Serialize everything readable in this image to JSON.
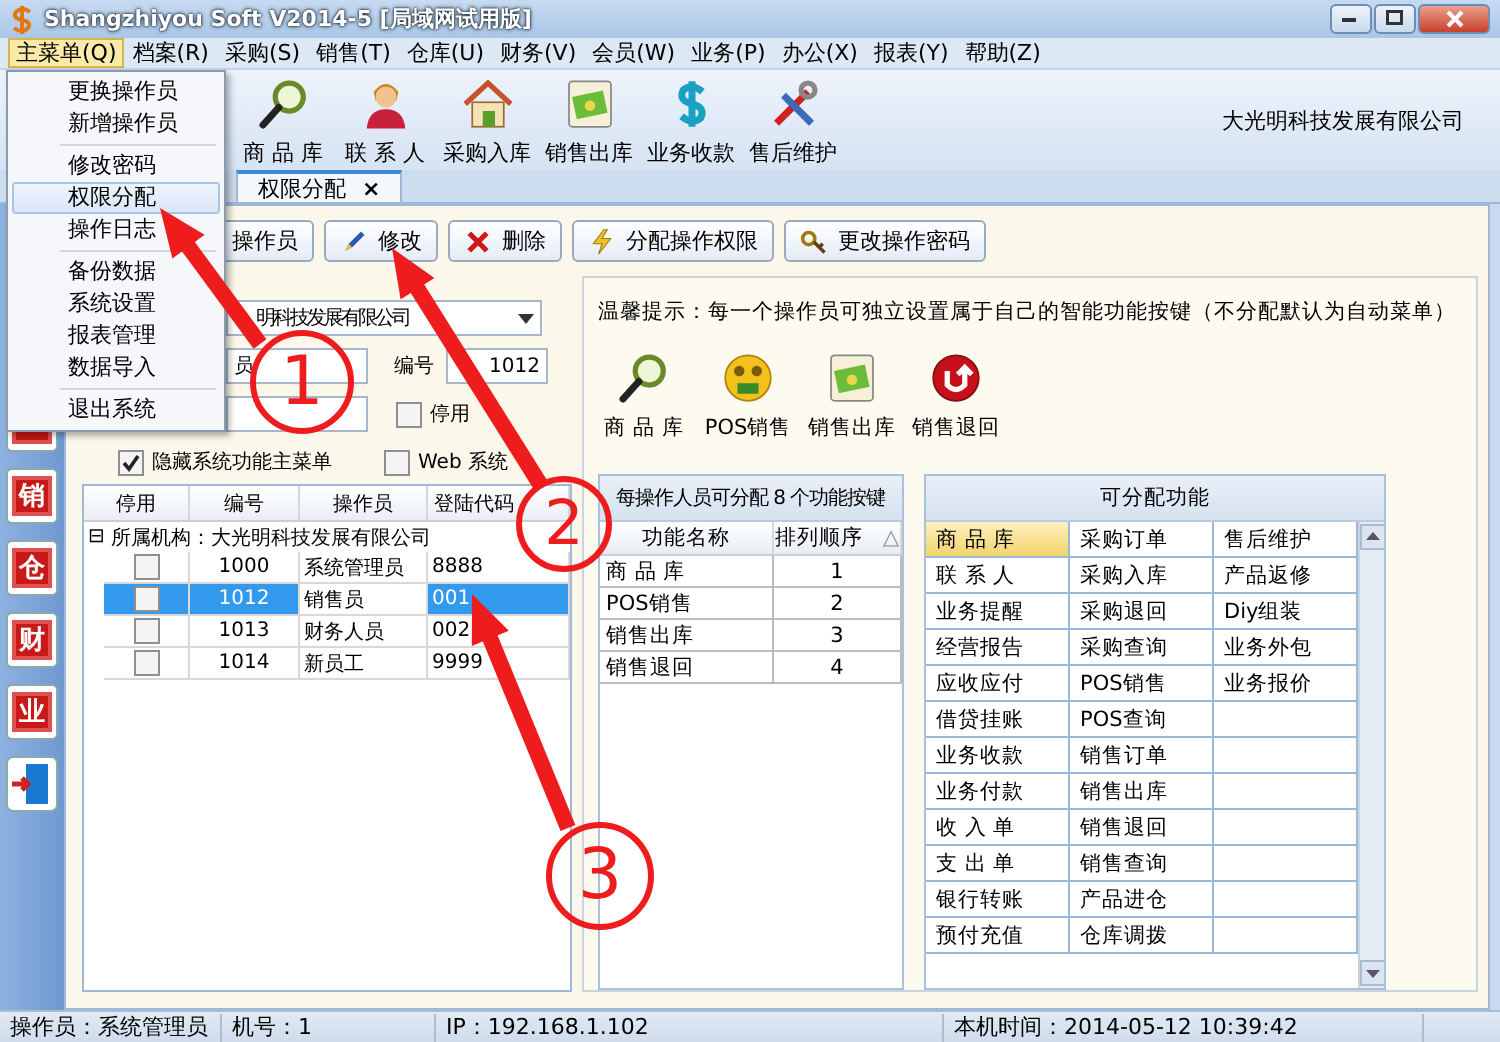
{
  "window": {
    "title": "Shangzhiyou Soft V2014-5 [局域网试用版]"
  },
  "menu_bar": [
    {
      "label": "主菜单(Q)",
      "selected": true
    },
    {
      "label": "档案(R)",
      "selected": false
    },
    {
      "label": "采购(S)",
      "selected": false
    },
    {
      "label": "销售(T)",
      "selected": false
    },
    {
      "label": "仓库(U)",
      "selected": false
    },
    {
      "label": "财务(V)",
      "selected": false
    },
    {
      "label": "会员(W)",
      "selected": false
    },
    {
      "label": "业务(P)",
      "selected": false
    },
    {
      "label": "办公(X)",
      "selected": false
    },
    {
      "label": "报表(Y)",
      "selected": false
    },
    {
      "label": "帮助(Z)",
      "selected": false
    }
  ],
  "main_menu": [
    {
      "kind": "item",
      "label": "更换操作员",
      "selected": false
    },
    {
      "kind": "item",
      "label": "新增操作员",
      "selected": false
    },
    {
      "kind": "separator"
    },
    {
      "kind": "item",
      "label": "修改密码",
      "selected": false
    },
    {
      "kind": "item",
      "label": "权限分配",
      "selected": true
    },
    {
      "kind": "item",
      "label": "操作日志",
      "selected": false
    },
    {
      "kind": "separator"
    },
    {
      "kind": "item",
      "label": "备份数据",
      "selected": false
    },
    {
      "kind": "item",
      "label": "系统设置",
      "selected": false
    },
    {
      "kind": "item",
      "label": "报表管理",
      "selected": false
    },
    {
      "kind": "item",
      "label": "数据导入",
      "selected": false
    },
    {
      "kind": "separator"
    },
    {
      "kind": "item",
      "label": "退出系统",
      "selected": false
    }
  ],
  "toolbar": {
    "buttons": [
      {
        "label": "商 品 库"
      },
      {
        "label": "联 系 人"
      },
      {
        "label": "采购入库"
      },
      {
        "label": "销售出库"
      },
      {
        "label": "业务收款"
      },
      {
        "label": "售后维护"
      }
    ],
    "company": "大光明科技发展有限公司"
  },
  "tabs": [
    {
      "label": "权限分配",
      "selected": true,
      "close": "×"
    }
  ],
  "sidebar": [
    {
      "kind": "stamp"
    },
    {
      "kind": "stamp",
      "label": "销"
    },
    {
      "kind": "stamp",
      "label": "仓"
    },
    {
      "kind": "stamp",
      "label": "财"
    },
    {
      "kind": "stamp",
      "label": "业"
    },
    {
      "kind": "door"
    }
  ],
  "actions": [
    {
      "label": "操作员"
    },
    {
      "label": "修改"
    },
    {
      "label": "删除"
    },
    {
      "label": "分配操作权限"
    },
    {
      "label": "更改操作密码"
    }
  ],
  "operator_form": {
    "organization": "明科技发展有限公司",
    "name": "员",
    "number_label": "编号",
    "number": "1012",
    "disabled": {
      "label": "停用",
      "checked": false
    },
    "hide_menu": {
      "label": "隐藏系统功能主菜单",
      "checked": true
    },
    "web_login": {
      "label": "Web 系统",
      "checked": false
    }
  },
  "operator_table": {
    "columns": [
      "停用",
      "编号",
      "操作员",
      "登陆代码"
    ],
    "group": {
      "toggle": "⊟",
      "label": "所属机构：大光明科技发展有限公司"
    },
    "rows": [
      {
        "disabled": false,
        "number": "1000",
        "operator": "系统管理员",
        "login_code": "8888",
        "selected": false
      },
      {
        "disabled": false,
        "number": "1012",
        "operator": "销售员",
        "login_code": "001",
        "selected": true
      },
      {
        "disabled": false,
        "number": "1013",
        "operator": "财务人员",
        "login_code": "002",
        "selected": false
      },
      {
        "disabled": false,
        "number": "1014",
        "operator": "新员工",
        "login_code": "9999",
        "selected": false
      }
    ]
  },
  "tip": "温馨提示：每一个操作员可独立设置属于自己的智能功能按键（不分配默认为自动菜单）",
  "shortcut_buttons": [
    {
      "label": "商 品 库"
    },
    {
      "label": "POS销售"
    },
    {
      "label": "销售出库"
    },
    {
      "label": "销售退回"
    }
  ],
  "assigned": {
    "title": "每操作人员可分配 8 个功能按键",
    "columns": [
      "功能名称",
      "排列顺序"
    ],
    "sort_indicator": "△",
    "rows": [
      {
        "name": "商 品 库",
        "order": "1"
      },
      {
        "name": "POS销售",
        "order": "2"
      },
      {
        "name": "销售出库",
        "order": "3"
      },
      {
        "name": "销售退回",
        "order": "4"
      }
    ]
  },
  "available": {
    "title": "可分配功能",
    "rows": [
      [
        {
          "label": "商 品 库",
          "selected": true
        },
        {
          "label": "采购订单",
          "selected": false
        },
        {
          "label": "售后维护",
          "selected": false
        }
      ],
      [
        {
          "label": "联 系 人",
          "selected": false
        },
        {
          "label": "采购入库",
          "selected": false
        },
        {
          "label": "产品返修",
          "selected": false
        }
      ],
      [
        {
          "label": "业务提醒",
          "selected": false
        },
        {
          "label": "采购退回",
          "selected": false
        },
        {
          "label": "Diy组装",
          "selected": false
        }
      ],
      [
        {
          "label": "经营报告",
          "selected": false
        },
        {
          "label": "采购查询",
          "selected": false
        },
        {
          "label": "业务外包",
          "selected": false
        }
      ],
      [
        {
          "label": "应收应付",
          "selected": false
        },
        {
          "label": "POS销售",
          "selected": false
        },
        {
          "label": "业务报价",
          "selected": false
        }
      ],
      [
        {
          "label": "借贷挂账",
          "selected": false
        },
        {
          "label": "POS查询",
          "selected": false
        }
      ],
      [
        {
          "label": "业务收款",
          "selected": false
        },
        {
          "label": "销售订单",
          "selected": false
        }
      ],
      [
        {
          "label": "业务付款",
          "selected": false
        },
        {
          "label": "销售出库",
          "selected": false
        }
      ],
      [
        {
          "label": "收 入 单",
          "selected": false
        },
        {
          "label": "销售退回",
          "selected": false
        }
      ],
      [
        {
          "label": "支 出 单",
          "selected": false
        },
        {
          "label": "销售查询",
          "selected": false
        }
      ],
      [
        {
          "label": "银行转账",
          "selected": false
        },
        {
          "label": "产品进仓",
          "selected": false
        }
      ],
      [
        {
          "label": "预付充值",
          "selected": false
        },
        {
          "label": "仓库调拨",
          "selected": false
        }
      ]
    ]
  },
  "status_bar": {
    "operator": "操作员：系统管理员",
    "machine": "机号：1",
    "ip": "IP：192.168.1.102",
    "time": "本机时间：2014-05-12 10:39:42"
  },
  "annotations": [
    {
      "number": "1"
    },
    {
      "number": "2"
    },
    {
      "number": "3"
    }
  ]
}
